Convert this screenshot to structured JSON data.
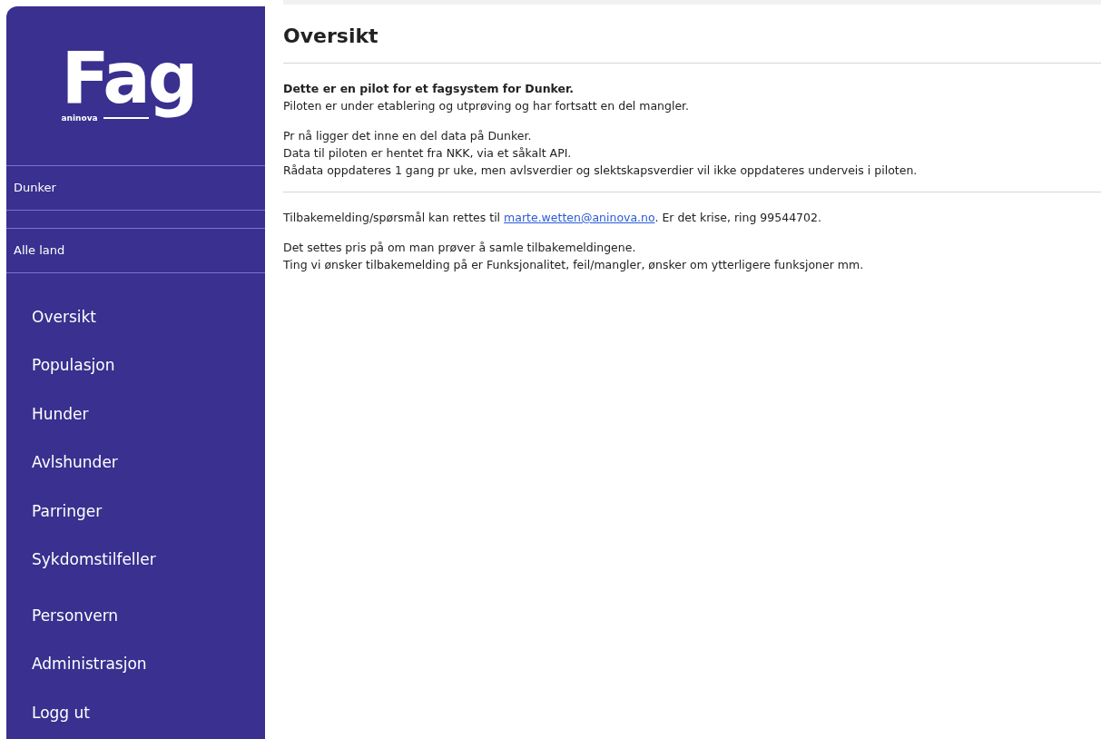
{
  "sidebar": {
    "logo": {
      "word": "Fag",
      "brand": "aninova"
    },
    "breed": "Dunker",
    "country": "Alle land",
    "nav_main": [
      "Oversikt",
      "Populasjon",
      "Hunder",
      "Avlshunder",
      "Parringer",
      "Sykdomstilfeller"
    ],
    "nav_secondary": [
      "Personvern",
      "Administrasjon",
      "Logg ut"
    ]
  },
  "main": {
    "title": "Oversikt",
    "sections": [
      {
        "paragraphs": [
          [
            {
              "kind": "bold",
              "text": "Dette er en pilot for et fagsystem for Dunker."
            },
            {
              "kind": "text",
              "text": "Piloten er under etablering og utprøving og har fortsatt en del mangler."
            }
          ],
          [
            {
              "kind": "text",
              "text": "Pr nå ligger det inne en del data på Dunker."
            },
            {
              "kind": "text",
              "text": "Data til piloten er hentet fra NKK, via et såkalt API."
            },
            {
              "kind": "text",
              "text": "Rådata oppdateres 1 gang pr uke, men avlsverdier og slektskapsverdier vil ikke oppdateres underveis i piloten."
            }
          ]
        ]
      },
      {
        "paragraphs": [
          [
            {
              "kind": "contact",
              "before": "Tilbakemelding/spørsmål kan rettes til ",
              "link": "marte.wetten@aninova.no",
              "after": ". Er det krise, ring 99544702."
            }
          ],
          [
            {
              "kind": "text",
              "text": "Det settes pris på om man prøver å samle tilbakemeldingene."
            },
            {
              "kind": "text",
              "text": "Ting vi ønsker tilbakemelding på er Funksjonalitet, feil/mangler, ønsker om ytterligere funksjoner mm."
            }
          ]
        ]
      }
    ]
  }
}
